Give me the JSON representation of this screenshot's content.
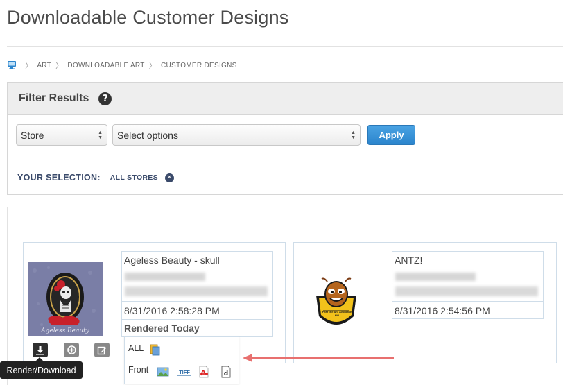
{
  "page": {
    "title": "Downloadable Customer Designs"
  },
  "breadcrumb": {
    "home_icon": "computer-icon",
    "items": [
      "ART",
      "DOWNLOADABLE ART",
      "CUSTOMER DESIGNS"
    ]
  },
  "filter": {
    "title": "Filter Results",
    "help_glyph": "?",
    "store_select": {
      "value": "Store"
    },
    "options_select": {
      "value": "Select options"
    },
    "apply_label": "Apply",
    "selection_label": "YOUR SELECTION:",
    "selection_value": "ALL STORES",
    "colors": {
      "apply": "#2b84cc",
      "selection_text": "#3a4a6a"
    }
  },
  "designs": [
    {
      "name": "Ageless Beauty - skull",
      "date": "8/31/2016 2:58:28 PM",
      "status": "Rendered Today",
      "thumbnail_icon": "skull-lady-logo",
      "thumbnail_caption": "Ageless Beauty"
    },
    {
      "name": "ANTZ!",
      "date": "8/31/2016 2:54:56 PM",
      "thumbnail_icon": "ant-shield-logo",
      "thumbnail_caption": "Fear the Ant Avoid the Hill"
    }
  ],
  "actions": {
    "download_icon": "download-icon",
    "target_icon": "crosshair-icon",
    "edit_icon": "edit-icon",
    "tooltip": "Render/Download"
  },
  "render_menu": {
    "all_label": "ALL",
    "front_label": "Front",
    "formats": [
      "image-icon",
      "tiff-icon",
      "pdf-icon",
      "document-icon"
    ]
  },
  "annotation": {
    "arrow_color": "#e8706f"
  }
}
